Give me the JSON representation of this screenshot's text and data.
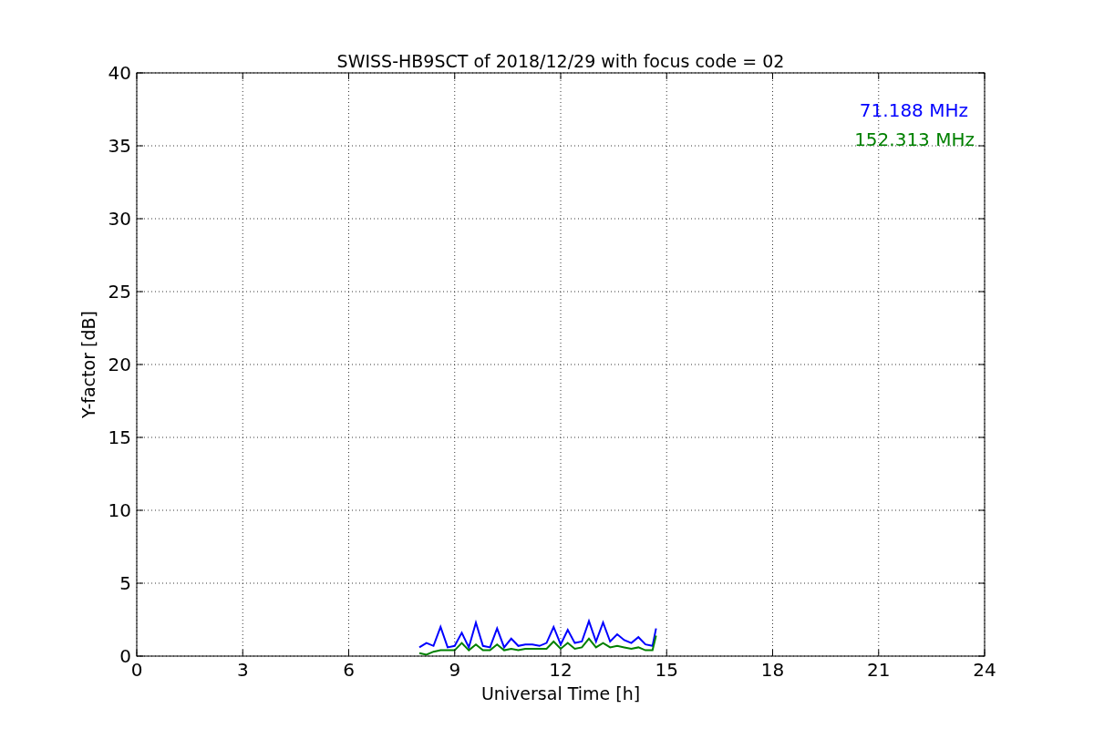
{
  "chart_data": {
    "type": "line",
    "title": "SWISS-HB9SCT of 2018/12/29 with focus code = 02",
    "xlabel": "Universal Time [h]",
    "ylabel": "Y-factor [dB]",
    "x": [
      8.0,
      8.2,
      8.4,
      8.6,
      8.8,
      9.0,
      9.2,
      9.4,
      9.6,
      9.8,
      10.0,
      10.2,
      10.4,
      10.6,
      10.8,
      11.0,
      11.2,
      11.4,
      11.6,
      11.8,
      12.0,
      12.2,
      12.4,
      12.6,
      12.8,
      13.0,
      13.2,
      13.4,
      13.6,
      13.8,
      14.0,
      14.2,
      14.4,
      14.6,
      14.7
    ],
    "series": [
      {
        "name": "71.188 MHz",
        "color": "#0000ff",
        "values": [
          0.6,
          0.9,
          0.7,
          2.0,
          0.6,
          0.7,
          1.6,
          0.6,
          2.3,
          0.7,
          0.6,
          1.9,
          0.6,
          1.2,
          0.7,
          0.8,
          0.8,
          0.7,
          0.9,
          2.0,
          0.8,
          1.8,
          0.9,
          1.0,
          2.4,
          1.0,
          2.3,
          1.0,
          1.5,
          1.1,
          0.9,
          1.3,
          0.8,
          0.7,
          1.9
        ]
      },
      {
        "name": "152.313 MHz",
        "color": "#008000",
        "values": [
          0.2,
          0.1,
          0.3,
          0.4,
          0.4,
          0.4,
          0.9,
          0.4,
          0.8,
          0.4,
          0.4,
          0.8,
          0.4,
          0.5,
          0.4,
          0.5,
          0.5,
          0.5,
          0.5,
          1.0,
          0.5,
          0.9,
          0.5,
          0.6,
          1.2,
          0.6,
          0.9,
          0.6,
          0.7,
          0.6,
          0.5,
          0.6,
          0.4,
          0.4,
          1.4
        ]
      }
    ],
    "grid": true,
    "xlim": [
      0,
      24
    ],
    "ylim": [
      0,
      40
    ],
    "xticks": [
      0,
      3,
      6,
      9,
      12,
      15,
      18,
      21,
      24
    ],
    "yticks": [
      0,
      5,
      10,
      15,
      20,
      25,
      30,
      35,
      40
    ]
  }
}
